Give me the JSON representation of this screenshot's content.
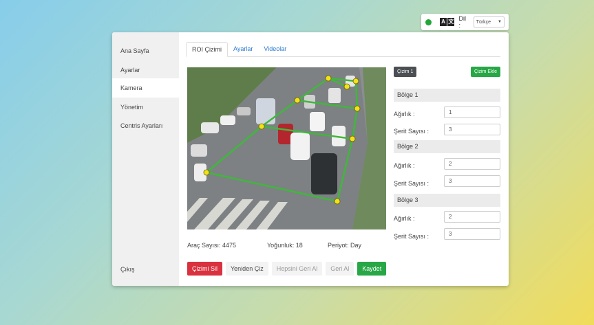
{
  "topbar": {
    "status_icon": "online-dot",
    "status_color": "#1fa838",
    "translate_icon": "translate-icon",
    "translate_glyphs": [
      "A",
      "文"
    ],
    "lang_label": "Dil :",
    "lang_value": "Türkçe",
    "lang_caret": "▼"
  },
  "sidebar": {
    "items": [
      {
        "label": "Ana Sayfa"
      },
      {
        "label": "Ayarlar"
      },
      {
        "label": "Kamera"
      },
      {
        "label": "Yönetim"
      },
      {
        "label": "Centris Ayarları"
      }
    ],
    "logout": "Çıkış"
  },
  "tabs": [
    {
      "label": "ROI Çizimi"
    },
    {
      "label": "Ayarlar"
    },
    {
      "label": "Videolar"
    }
  ],
  "stats": {
    "vehicle_count": "Araç Sayısı: 4475",
    "density": "Yoğunluk: 18",
    "period": "Periyot: Day"
  },
  "buttons": {
    "delete": "Çizimi Sil",
    "redraw": "Yeniden Çiz",
    "undo_all": "Hepsini Geri Al",
    "undo": "Geri Al",
    "save": "Kaydet"
  },
  "panel": {
    "drawing_chip": "Çizim 1",
    "add_drawing": "Çizim Ekle",
    "regions": [
      {
        "title": "Bölge 1",
        "weight_label": "Ağırlık :",
        "weight": "1",
        "lanes_label": "Şerit Sayısı :",
        "lanes": "3"
      },
      {
        "title": "Bölge 2",
        "weight_label": "Ağırlık :",
        "weight": "2",
        "lanes_label": "Şerit Sayısı :",
        "lanes": "3"
      },
      {
        "title": "Bölge 3",
        "weight_label": "Ağırlık :",
        "weight": "2",
        "lanes_label": "Şerit Sayısı :",
        "lanes": "3"
      }
    ]
  },
  "colors": {
    "accent_blue": "#2b7bd0",
    "danger": "#d9313e",
    "success": "#27a745",
    "roi_line": "#3fb83a",
    "roi_handle": "#f3e21a"
  }
}
